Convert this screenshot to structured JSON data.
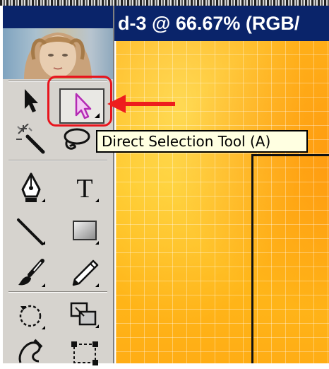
{
  "document": {
    "title": "d-3 @ 66.67% (RGB/",
    "zoom": "66.67%",
    "color_mode": "RGB"
  },
  "toolbox": {
    "tools": [
      {
        "id": "selection-tool",
        "icon": "black-arrow-icon"
      },
      {
        "id": "direct-selection-tool",
        "icon": "white-arrow-icon",
        "selected": true
      },
      {
        "id": "magic-wand-tool",
        "icon": "magic-wand-icon"
      },
      {
        "id": "lasso-tool",
        "icon": "lasso-icon"
      },
      {
        "id": "pen-tool",
        "icon": "pen-icon"
      },
      {
        "id": "type-tool",
        "icon": "type-icon",
        "glyph": "T"
      },
      {
        "id": "line-tool",
        "icon": "line-icon"
      },
      {
        "id": "rectangle-tool",
        "icon": "rectangle-icon"
      },
      {
        "id": "paintbrush-tool",
        "icon": "paintbrush-icon"
      },
      {
        "id": "pencil-tool",
        "icon": "pencil-icon"
      },
      {
        "id": "rotate-tool",
        "icon": "rotate-icon"
      },
      {
        "id": "scale-tool",
        "icon": "scale-icon"
      },
      {
        "id": "warp-tool",
        "icon": "warp-icon"
      },
      {
        "id": "free-transform-tool",
        "icon": "free-transform-icon"
      }
    ]
  },
  "tooltip": {
    "text": "Direct Selection Tool (A)"
  },
  "annotation": {
    "arrow_color": "#ee1d1d",
    "ring_color": "#e8141d"
  },
  "colors": {
    "title_bar": "#0a246a",
    "toolbox_bg": "#d6d3ce",
    "canvas": "#ffb21a",
    "tooltip_bg": "#ffffe1"
  }
}
